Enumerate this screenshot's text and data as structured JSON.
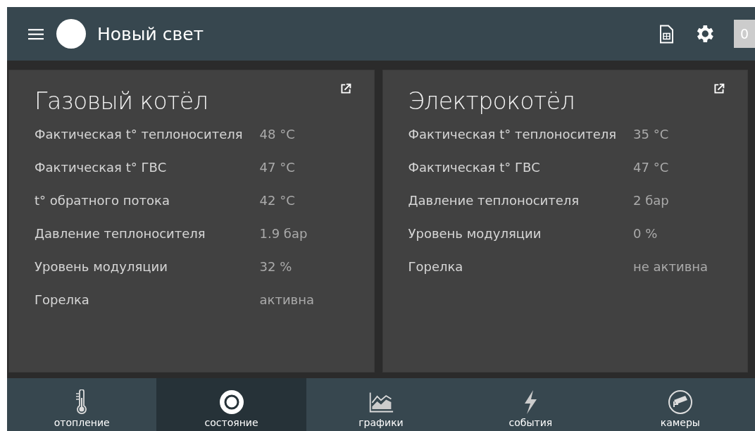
{
  "app_bar": {
    "title": "Новый свет",
    "badge": "0"
  },
  "cards": [
    {
      "title": "Газовый котёл",
      "rows": [
        {
          "label": "Фактическая t° теплоносителя",
          "value": "48 °C"
        },
        {
          "label": "Фактическая t° ГВС",
          "value": "47 °C"
        },
        {
          "label": "t° обратного потока",
          "value": "42 °C"
        },
        {
          "label": "Давление теплоносителя",
          "value": "1.9 бар"
        },
        {
          "label": "Уровень модуляции",
          "value": "32 %"
        },
        {
          "label": "Горелка",
          "value": "активна"
        }
      ]
    },
    {
      "title": "Электрокотёл",
      "rows": [
        {
          "label": "Фактическая t° теплоносителя",
          "value": "35 °C"
        },
        {
          "label": "Фактическая t° ГВС",
          "value": "47 °C"
        },
        {
          "label": "Давление теплоносителя",
          "value": "2 бар"
        },
        {
          "label": "Уровень модуляции",
          "value": "0 %"
        },
        {
          "label": "Горелка",
          "value": "не активна"
        }
      ]
    }
  ],
  "tabs": [
    {
      "label": "отопление",
      "kind": "thermometer",
      "selected": false
    },
    {
      "label": "состояние",
      "kind": "status",
      "selected": true
    },
    {
      "label": "графики",
      "kind": "chart",
      "selected": false
    },
    {
      "label": "события",
      "kind": "lightning",
      "selected": false
    },
    {
      "label": "камеры",
      "kind": "camera",
      "selected": false
    }
  ]
}
